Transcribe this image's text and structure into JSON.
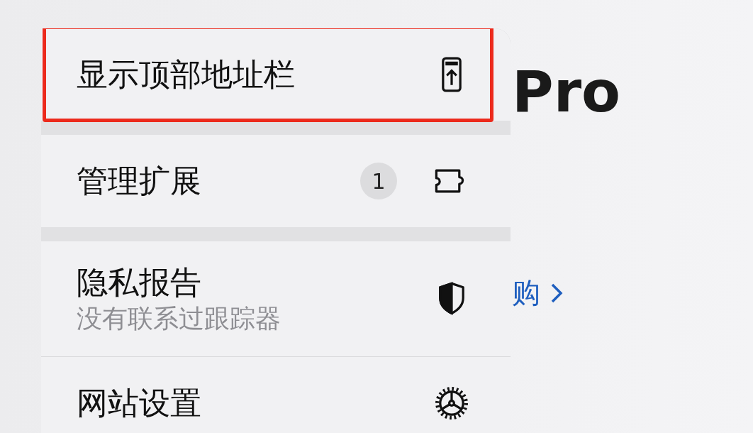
{
  "menu": {
    "groups": [
      {
        "items": [
          {
            "label": "显示顶部地址栏",
            "kind": "address-bar",
            "highlighted": true
          }
        ]
      },
      {
        "items": [
          {
            "label": "管理扩展",
            "badge": "1",
            "kind": "extensions",
            "highlighted": false
          }
        ]
      },
      {
        "items": [
          {
            "label": "隐私报告",
            "subtitle": "没有联系过跟踪器",
            "kind": "privacy",
            "highlighted": false
          },
          {
            "label": "网站设置",
            "kind": "settings",
            "highlighted": false
          }
        ]
      }
    ]
  },
  "background_page": {
    "heading": "Pro",
    "link": "购"
  }
}
